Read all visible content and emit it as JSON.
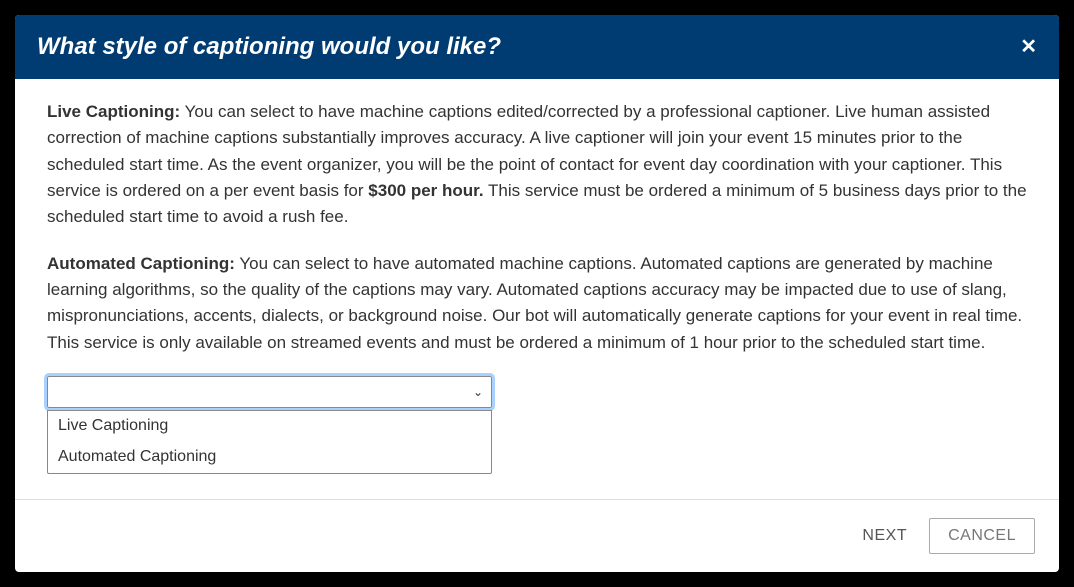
{
  "header": {
    "title": "What style of captioning would you like?",
    "close_label": "✕"
  },
  "body": {
    "live": {
      "label": "Live Captioning:",
      "text_before_price": " You can select to have machine captions edited/corrected by a professional captioner. Live human assisted correction of machine captions substantially improves accuracy. A live captioner will join your event 15 minutes prior to the scheduled start time. As the event organizer, you will be the point of contact for event day coordination with your captioner. This service is ordered on a per event basis for ",
      "price": "$300 per hour.",
      "text_after_price": " This service must be ordered a minimum of 5 business days prior to the scheduled start time to avoid a rush fee."
    },
    "automated": {
      "label": "Automated Captioning:",
      "text": " You can select to have automated machine captions. Automated captions are generated by machine learning algorithms, so the quality of the captions may vary. Automated captions accuracy may be impacted due to use of slang, mispronunciations, accents, dialects, or background noise. Our bot will automatically generate captions for your event in real time. This service is only available on streamed events and must be ordered a minimum of 1 hour prior to the scheduled start time."
    }
  },
  "select": {
    "options": {
      "0": {
        "label": "Live Captioning"
      },
      "1": {
        "label": "Automated Captioning"
      }
    }
  },
  "footer": {
    "next_label": "NEXT",
    "cancel_label": "CANCEL"
  }
}
